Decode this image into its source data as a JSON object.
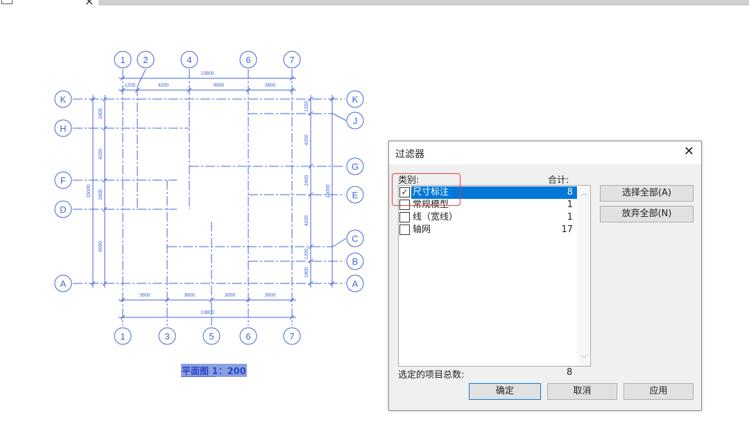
{
  "tab": {
    "close_icon": "×"
  },
  "drawing": {
    "line_color": "#3f63d8",
    "vertical_grids": [
      "1",
      "2",
      "3",
      "4",
      "5",
      "6",
      "7"
    ],
    "horizontal_grids": [
      "K",
      "J",
      "H",
      "G",
      "F",
      "E",
      "D",
      "C",
      "B",
      "A"
    ],
    "top_bubbles": [
      "1",
      "2",
      "4",
      "6",
      "7"
    ],
    "bottom_bubbles": [
      "1",
      "3",
      "5",
      "6",
      "7"
    ],
    "left_bubbles": [
      "K",
      "H",
      "F",
      "D",
      "A"
    ],
    "right_bubbles": [
      "K",
      "J",
      "G",
      "E",
      "C",
      "B",
      "A"
    ],
    "top_overall": "13800",
    "top_segments": [
      "1200",
      "4200",
      "4800",
      "3600"
    ],
    "bottom_segments": [
      "3600",
      "3600",
      "3000",
      "3600"
    ],
    "bottom_overall": "13800",
    "left_overall": "15000",
    "left_segments": [
      "2400",
      "4200",
      "2400",
      "6000"
    ],
    "right_overall": "15000",
    "right_segments": [
      "1200",
      "4200",
      "2400",
      "4200",
      "1200",
      "1800"
    ],
    "caption": "平面图 1：200"
  },
  "dialog": {
    "title": "过滤器",
    "category_label": "类别:",
    "total_label": "合计:",
    "items": [
      {
        "name": "尺寸标注",
        "count": "8",
        "checked": true,
        "selected": true
      },
      {
        "name": "常规模型",
        "count": "1",
        "checked": false,
        "selected": false
      },
      {
        "name": "线（宽线）",
        "count": "1",
        "checked": false,
        "selected": false
      },
      {
        "name": "轴网",
        "count": "17",
        "checked": false,
        "selected": false
      }
    ],
    "select_all": "选择全部(A)",
    "deselect_all": "放弃全部(N)",
    "selected_total_label": "选定的项目总数:",
    "selected_total": "8",
    "ok": "确定",
    "cancel": "取消",
    "apply": "应用",
    "highlight_color": "#0078d7",
    "annotation_color": "#e53935"
  }
}
